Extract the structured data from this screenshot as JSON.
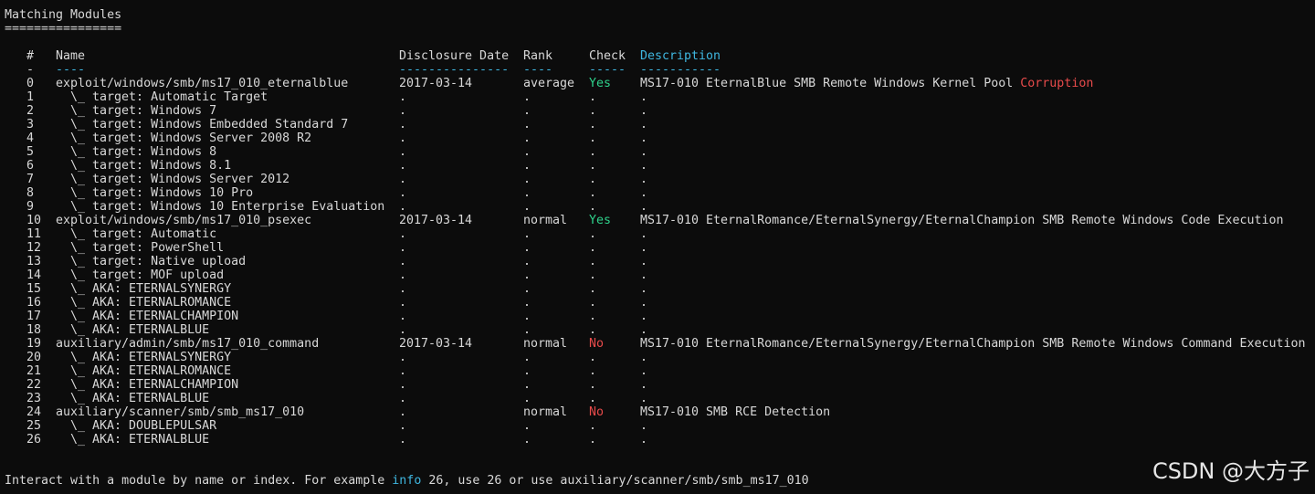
{
  "title": "Matching Modules",
  "underline": "================",
  "headers": {
    "num": "#",
    "name": "Name",
    "date": "Disclosure Date",
    "rank": "Rank",
    "check": "Check",
    "desc": "Description"
  },
  "dashes": {
    "num": "-",
    "name": "----",
    "date": "---------------",
    "rank": "----",
    "check": "-----",
    "desc": "-----------"
  },
  "rows": [
    {
      "num": "0",
      "name": "exploit/windows/smb/ms17_010_eternalblue",
      "date": "2017-03-14",
      "rank": "average",
      "check": "Yes",
      "check_status": "yes",
      "desc": "MS17-010 EternalBlue SMB Remote Windows Kernel Pool ",
      "desc_hl": "Corruption"
    },
    {
      "num": "1",
      "name": "  \\_ target: Automatic Target",
      "date": ".",
      "rank": ".",
      "check": ".",
      "desc": "."
    },
    {
      "num": "2",
      "name": "  \\_ target: Windows 7",
      "date": ".",
      "rank": ".",
      "check": ".",
      "desc": "."
    },
    {
      "num": "3",
      "name": "  \\_ target: Windows Embedded Standard 7",
      "date": ".",
      "rank": ".",
      "check": ".",
      "desc": "."
    },
    {
      "num": "4",
      "name": "  \\_ target: Windows Server 2008 R2",
      "date": ".",
      "rank": ".",
      "check": ".",
      "desc": "."
    },
    {
      "num": "5",
      "name": "  \\_ target: Windows 8",
      "date": ".",
      "rank": ".",
      "check": ".",
      "desc": "."
    },
    {
      "num": "6",
      "name": "  \\_ target: Windows 8.1",
      "date": ".",
      "rank": ".",
      "check": ".",
      "desc": "."
    },
    {
      "num": "7",
      "name": "  \\_ target: Windows Server 2012",
      "date": ".",
      "rank": ".",
      "check": ".",
      "desc": "."
    },
    {
      "num": "8",
      "name": "  \\_ target: Windows 10 Pro",
      "date": ".",
      "rank": ".",
      "check": ".",
      "desc": "."
    },
    {
      "num": "9",
      "name": "  \\_ target: Windows 10 Enterprise Evaluation",
      "date": ".",
      "rank": ".",
      "check": ".",
      "desc": "."
    },
    {
      "num": "10",
      "name": "exploit/windows/smb/ms17_010_psexec",
      "date": "2017-03-14",
      "rank": "normal",
      "check": "Yes",
      "check_status": "yes",
      "desc": "MS17-010 EternalRomance/EternalSynergy/EternalChampion SMB Remote Windows Code Execution"
    },
    {
      "num": "11",
      "name": "  \\_ target: Automatic",
      "date": ".",
      "rank": ".",
      "check": ".",
      "desc": "."
    },
    {
      "num": "12",
      "name": "  \\_ target: PowerShell",
      "date": ".",
      "rank": ".",
      "check": ".",
      "desc": "."
    },
    {
      "num": "13",
      "name": "  \\_ target: Native upload",
      "date": ".",
      "rank": ".",
      "check": ".",
      "desc": "."
    },
    {
      "num": "14",
      "name": "  \\_ target: MOF upload",
      "date": ".",
      "rank": ".",
      "check": ".",
      "desc": "."
    },
    {
      "num": "15",
      "name": "  \\_ AKA: ETERNALSYNERGY",
      "date": ".",
      "rank": ".",
      "check": ".",
      "desc": "."
    },
    {
      "num": "16",
      "name": "  \\_ AKA: ETERNALROMANCE",
      "date": ".",
      "rank": ".",
      "check": ".",
      "desc": "."
    },
    {
      "num": "17",
      "name": "  \\_ AKA: ETERNALCHAMPION",
      "date": ".",
      "rank": ".",
      "check": ".",
      "desc": "."
    },
    {
      "num": "18",
      "name": "  \\_ AKA: ETERNALBLUE",
      "date": ".",
      "rank": ".",
      "check": ".",
      "desc": "."
    },
    {
      "num": "19",
      "name": "auxiliary/admin/smb/ms17_010_command",
      "date": "2017-03-14",
      "rank": "normal",
      "check": "No",
      "check_status": "no",
      "desc": "MS17-010 EternalRomance/EternalSynergy/EternalChampion SMB Remote Windows Command Execution"
    },
    {
      "num": "20",
      "name": "  \\_ AKA: ETERNALSYNERGY",
      "date": ".",
      "rank": ".",
      "check": ".",
      "desc": "."
    },
    {
      "num": "21",
      "name": "  \\_ AKA: ETERNALROMANCE",
      "date": ".",
      "rank": ".",
      "check": ".",
      "desc": "."
    },
    {
      "num": "22",
      "name": "  \\_ AKA: ETERNALCHAMPION",
      "date": ".",
      "rank": ".",
      "check": ".",
      "desc": "."
    },
    {
      "num": "23",
      "name": "  \\_ AKA: ETERNALBLUE",
      "date": ".",
      "rank": ".",
      "check": ".",
      "desc": "."
    },
    {
      "num": "24",
      "name": "auxiliary/scanner/smb/smb_ms17_010",
      "date": ".",
      "rank": "normal",
      "check": "No",
      "check_status": "no",
      "desc": "MS17-010 SMB RCE Detection"
    },
    {
      "num": "25",
      "name": "  \\_ AKA: DOUBLEPULSAR",
      "date": ".",
      "rank": ".",
      "check": ".",
      "desc": "."
    },
    {
      "num": "26",
      "name": "  \\_ AKA: ETERNALBLUE",
      "date": ".",
      "rank": ".",
      "check": ".",
      "desc": "."
    }
  ],
  "footer": {
    "prefix": "Interact with a module by name or index. For example ",
    "info_cmd": "info",
    "suffix": " 26, use 26 or use auxiliary/scanner/smb/smb_ms17_010"
  },
  "watermark": "CSDN @大方子",
  "colors": {
    "background": "#0c0c0c",
    "text": "#d8d8d8",
    "accent_blue": "#3fb7e0",
    "yes_green": "#2ed08a",
    "no_red": "#e84b4b"
  }
}
